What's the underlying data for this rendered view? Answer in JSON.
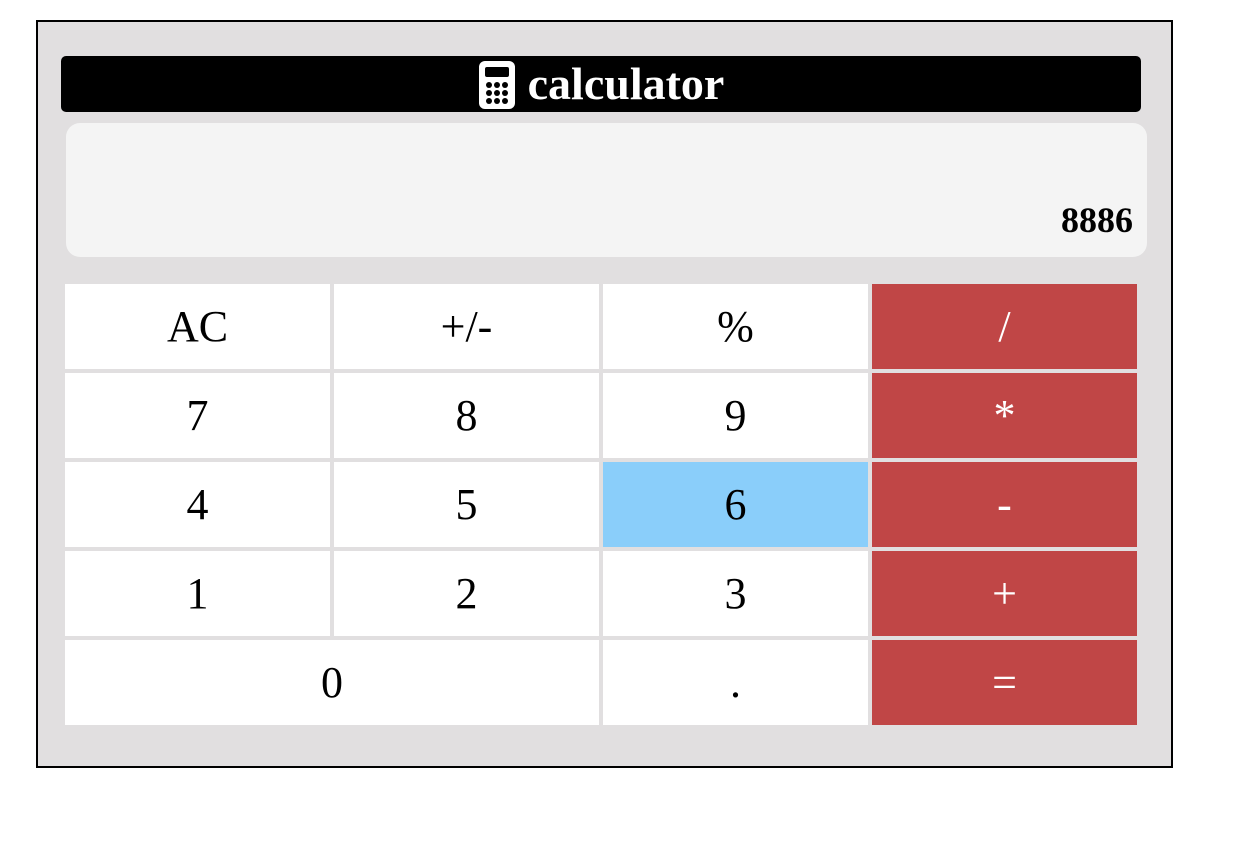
{
  "title": {
    "text": "calculator",
    "icon": "calculator-icon"
  },
  "display": {
    "value": "8886"
  },
  "keys": {
    "ac": "AC",
    "sign": "+/-",
    "percent": "%",
    "divide": "/",
    "seven": "7",
    "eight": "8",
    "nine": "9",
    "multiply": "*",
    "four": "4",
    "five": "5",
    "six": "6",
    "subtract": "-",
    "one": "1",
    "two": "2",
    "three": "3",
    "add": "+",
    "zero": "0",
    "decimal": ".",
    "equals": "="
  },
  "state": {
    "highlighted_key": "6"
  },
  "colors": {
    "frame_bg": "#e1dfe0",
    "title_bg": "#000000",
    "display_bg": "#f4f4f4",
    "operator_bg": "#c04646",
    "highlight_bg": "#8acefa",
    "key_bg": "#ffffff"
  }
}
